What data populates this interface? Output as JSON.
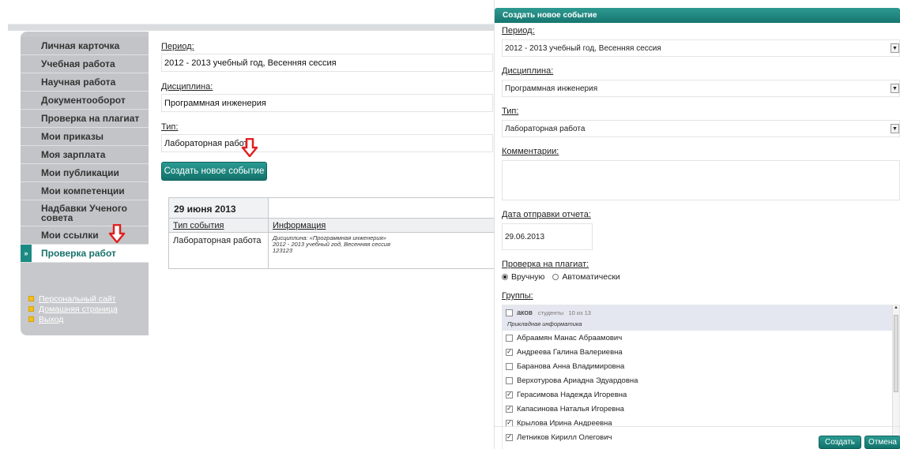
{
  "sidebar": {
    "items": [
      {
        "label": "Личная карточка"
      },
      {
        "label": "Учебная работа"
      },
      {
        "label": "Научная работа"
      },
      {
        "label": "Документооборот"
      },
      {
        "label": "Проверка на плагиат"
      },
      {
        "label": "Мои приказы"
      },
      {
        "label": "Моя зарплата"
      },
      {
        "label": "Мои публикации"
      },
      {
        "label": "Мои компетенции"
      },
      {
        "label": "Надбавки Ученого совета"
      },
      {
        "label": "Мои ссылки"
      },
      {
        "label": "Проверка работ"
      }
    ],
    "active_marker": "»",
    "links": [
      {
        "label": "Персональный сайт"
      },
      {
        "label": "Домашняя страница"
      },
      {
        "label": "Выход"
      }
    ]
  },
  "form": {
    "period_label": "Период:",
    "period_value": "2012 - 2013 учебный год, Весенняя сессия",
    "discipline_label": "Дисциплина:",
    "discipline_value": "Программная инженерия",
    "type_label": "Тип:",
    "type_value": "Лабораторная работа",
    "create_button": "Создать новое событие"
  },
  "events": {
    "date": "29 июня 2013",
    "col_type": "Тип события",
    "col_info": "Информация",
    "row_type": "Лабораторная работа",
    "row_info_line1": "Дисциплина: «Программная инженерия»",
    "row_info_line2": "2012 - 2013 учебный год, Весенняя сессия",
    "row_info_line3": "123123"
  },
  "modal": {
    "title": "Создать новое событие",
    "period_label": "Период:",
    "period_value": "2012 - 2013 учебный год, Весенняя сессия",
    "discipline_label": "Дисциплина:",
    "discipline_value": "Программная инженерия",
    "type_label": "Тип:",
    "type_value": "Лабораторная работа",
    "comments_label": "Комментарии:",
    "report_date_label": "Дата отправки отчета:",
    "report_date_value": "29.06.2013",
    "plagiarism_label": "Проверка на плагиат:",
    "plagiarism_options": [
      {
        "label": "Вручную",
        "selected": true
      },
      {
        "label": "Автоматически",
        "selected": false
      }
    ],
    "groups_label": "Группы:",
    "group": {
      "code": "аков",
      "students_word": "студенты",
      "count_text": "10 из 13",
      "program": "Прикладная информатика",
      "checked": false
    },
    "students": [
      {
        "name": "Абраамян Манас Абраамович",
        "checked": false
      },
      {
        "name": "Андреева Галина Валериевна",
        "checked": true
      },
      {
        "name": "Баранова Анна Владимировна",
        "checked": false
      },
      {
        "name": "Верхотурова Ариадна Эдуардовна",
        "checked": false
      },
      {
        "name": "Герасимова Надежда Игоревна",
        "checked": true
      },
      {
        "name": "Капасинова Наталья Игоревна",
        "checked": true
      },
      {
        "name": "Крылова Ирина Андреевна",
        "checked": true
      },
      {
        "name": "Летников Кирилл Олегович",
        "checked": true
      }
    ],
    "create_button": "Создать",
    "cancel_button": "Отмена"
  },
  "icons": {
    "dropdown_arrow": "▼",
    "checkmark": "✓",
    "scroll_up": "▲",
    "scroll_down": "▼"
  },
  "colors": {
    "accent": "#1b8a82",
    "arrow": "#e02020",
    "link_bullet": "#f0c020"
  }
}
